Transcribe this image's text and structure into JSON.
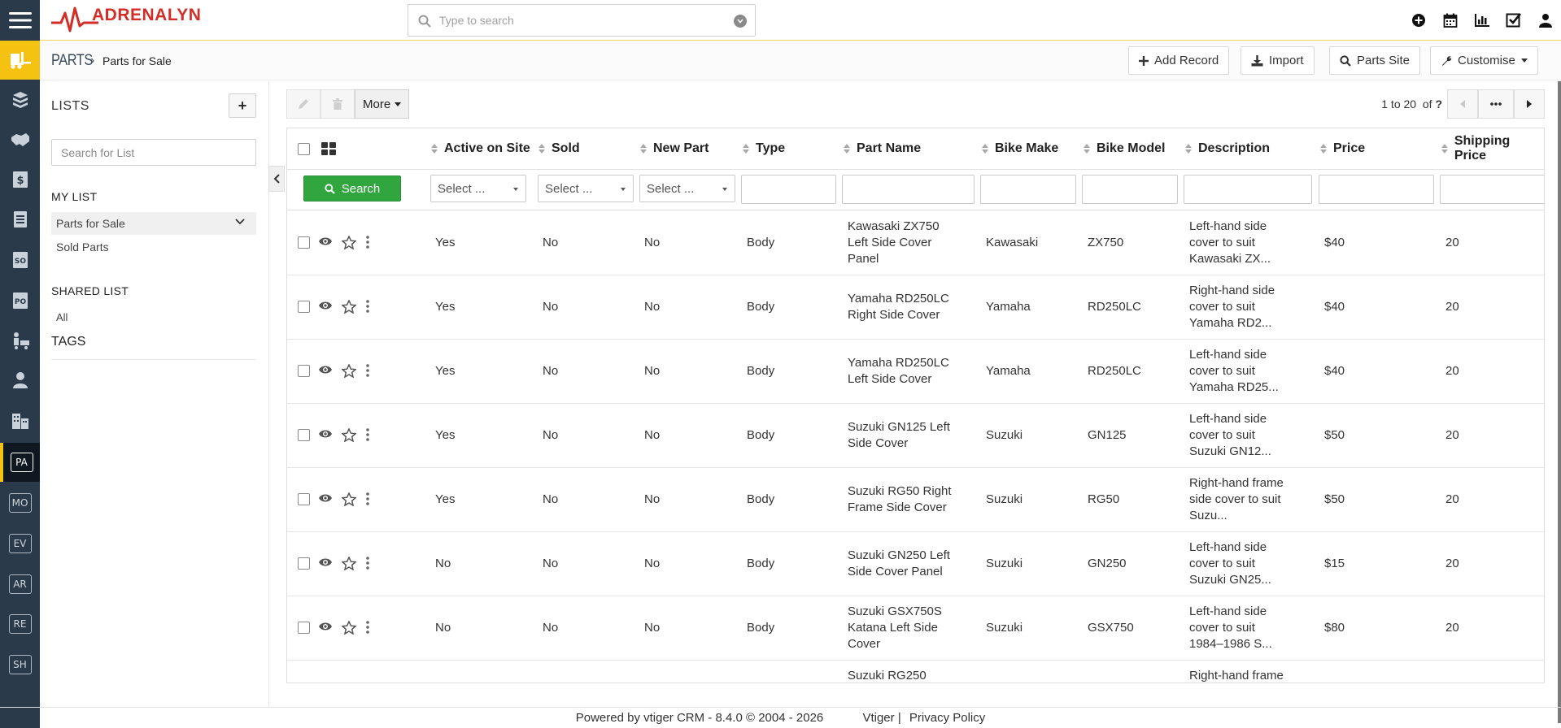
{
  "app": {
    "logo_text": "ADRENALYN",
    "search_placeholder": "Type to search"
  },
  "rail": {
    "modules": [
      "PA",
      "MO",
      "EV",
      "AR",
      "RE",
      "SH"
    ]
  },
  "breadcrumb": {
    "module": "PARTS",
    "page": "Parts for Sale"
  },
  "actions": {
    "add_record": "Add Record",
    "import": "Import",
    "parts_site": "Parts Site",
    "customise": "Customise"
  },
  "lists_panel": {
    "title": "LISTS",
    "add_label": "+",
    "search_placeholder": "Search for List",
    "my_list_header": "MY LIST",
    "my_list_items": [
      "Parts for Sale",
      "Sold Parts"
    ],
    "shared_list_header": "SHARED LIST",
    "shared_list_items": [
      "All"
    ],
    "tags_header": "TAGS"
  },
  "toolbar": {
    "more_label": "More"
  },
  "pager": {
    "range": "1 to 20",
    "of_label": "of",
    "total": "?"
  },
  "table": {
    "search_label": "Search",
    "select_placeholder": "Select ...",
    "columns": [
      "Active on Site",
      "Sold",
      "New Part",
      "Type",
      "Part Name",
      "Bike Make",
      "Bike Model",
      "Description",
      "Price",
      "Shipping Price"
    ],
    "rows": [
      {
        "active": "Yes",
        "sold": "No",
        "new_part": "No",
        "type": "Body",
        "part_name": [
          "Kawasaki ZX750",
          "Left Side Cover",
          "Panel"
        ],
        "make": "Kawasaki",
        "model": "ZX750",
        "desc": [
          "Left-hand side",
          "cover to suit",
          "Kawasaki ZX..."
        ],
        "price": "$40",
        "shipping": "20"
      },
      {
        "active": "Yes",
        "sold": "No",
        "new_part": "No",
        "type": "Body",
        "part_name": [
          "Yamaha RD250LC",
          "Right Side Cover"
        ],
        "make": "Yamaha",
        "model": "RD250LC",
        "desc": [
          "Right-hand side",
          "cover to suit",
          "Yamaha RD2..."
        ],
        "price": "$40",
        "shipping": "20"
      },
      {
        "active": "Yes",
        "sold": "No",
        "new_part": "No",
        "type": "Body",
        "part_name": [
          "Yamaha RD250LC",
          "Left Side Cover"
        ],
        "make": "Yamaha",
        "model": "RD250LC",
        "desc": [
          "Left-hand side",
          "cover to suit",
          "Yamaha RD25..."
        ],
        "price": "$40",
        "shipping": "20"
      },
      {
        "active": "Yes",
        "sold": "No",
        "new_part": "No",
        "type": "Body",
        "part_name": [
          "Suzuki GN125 Left",
          "Side Cover"
        ],
        "make": "Suzuki",
        "model": "GN125",
        "desc": [
          "Left-hand side",
          "cover to suit",
          "Suzuki GN12..."
        ],
        "price": "$50",
        "shipping": "20"
      },
      {
        "active": "Yes",
        "sold": "No",
        "new_part": "No",
        "type": "Body",
        "part_name": [
          "Suzuki RG50 Right",
          "Frame Side Cover"
        ],
        "make": "Suzuki",
        "model": "RG50",
        "desc": [
          "Right-hand frame",
          "side cover to suit",
          "Suzu..."
        ],
        "price": "$50",
        "shipping": "20"
      },
      {
        "active": "No",
        "sold": "No",
        "new_part": "No",
        "type": "Body",
        "part_name": [
          "Suzuki GN250 Left",
          "Side Cover Panel"
        ],
        "make": "Suzuki",
        "model": "GN250",
        "desc": [
          "Left-hand side",
          "cover to suit",
          "Suzuki GN25..."
        ],
        "price": "$15",
        "shipping": "20"
      },
      {
        "active": "No",
        "sold": "No",
        "new_part": "No",
        "type": "Body",
        "part_name": [
          "Suzuki GSX750S",
          "Katana Left Side",
          "Cover"
        ],
        "make": "Suzuki",
        "model": "GSX750",
        "desc": [
          "Left-hand side",
          "cover to suit",
          "1984–1986 S..."
        ],
        "price": "$80",
        "shipping": "20"
      },
      {
        "active": "",
        "sold": "",
        "new_part": "",
        "type": "",
        "part_name": [
          "Suzuki RG250"
        ],
        "make": "",
        "model": "",
        "desc": [
          "Right-hand frame"
        ],
        "price": "",
        "shipping": ""
      }
    ]
  },
  "footer": {
    "powered": "Powered by vtiger CRM - 8.4.0  © 2004 - 2026",
    "vtiger": "Vtiger",
    "sep": "|",
    "privacy": "Privacy Policy"
  },
  "colors": {
    "rail_bg": "#2b3a4a",
    "accent_yellow": "#f5c211",
    "search_green": "#31a63e",
    "logo_red": "#d32d27"
  }
}
